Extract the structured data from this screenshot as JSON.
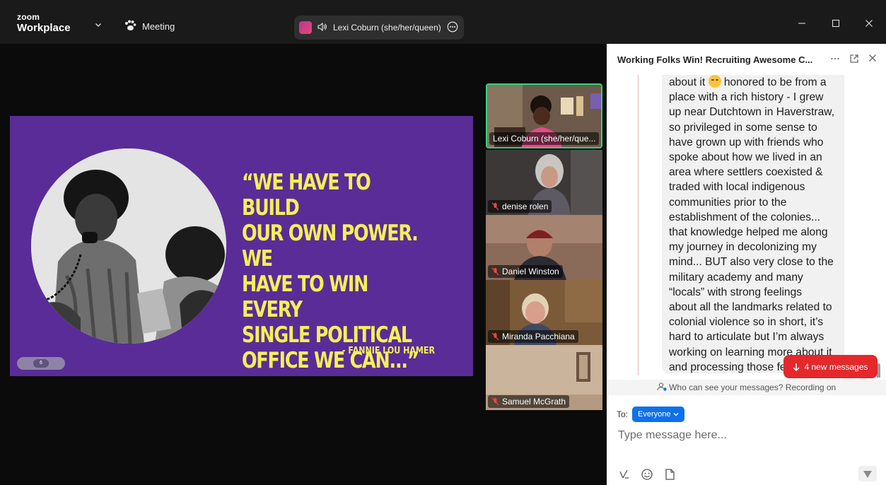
{
  "titlebar": {
    "brand_top": "zoom",
    "brand_bottom": "Workplace",
    "meeting_label": "Meeting",
    "active_speaker": "Lexi Coburn (she/her/queen)"
  },
  "slide": {
    "quote": "“WE HAVE TO BUILD\nOUR OWN POWER. WE\nHAVE TO WIN EVERY\nSINGLE POLITICAL\nOFFICE WE CAN...”",
    "attribution": "-   FANNIE LOU HAMER",
    "page_number": "6"
  },
  "participants": [
    {
      "name": "Lexi Coburn (she/her/que...",
      "muted": false,
      "active": true
    },
    {
      "name": "denise rolen",
      "muted": true,
      "active": false
    },
    {
      "name": "Daniel Winston",
      "muted": true,
      "active": false
    },
    {
      "name": "Miranda Pacchiana",
      "muted": true,
      "active": false
    },
    {
      "name": "Samuel McGrath",
      "muted": true,
      "active": false
    }
  ],
  "chat": {
    "title": "Working Folks Win! Recruiting Awesome C...",
    "message_lines": [
      "about it",
      " honored to be from a",
      "place with a rich history - I grew",
      "up near Dutchtown in Haverstraw,",
      "so privileged in some sense to",
      "have grown up with friends who",
      "spoke about how we lived in an",
      "area where settlers coexisted &",
      "traded with local indigenous",
      "communities prior to the",
      "establishment of the colonies...",
      "that knowledge helped me along",
      "my journey in decolonizing my",
      "mind... BUT also very close to the",
      "military academy and many",
      "“locals” with strong feelings",
      "about all the landmarks related to",
      "colonial violence so in short, it’s",
      "hard to articulate but I’m always",
      "working on learning more about it",
      "and processing those fe"
    ],
    "new_messages": "4 new messages",
    "privacy_notice": "Who can see your messages? Recording on",
    "to_label": "To:",
    "recipient": "Everyone",
    "input_placeholder": "Type message here..."
  },
  "colors": {
    "slide_bg": "#5a2c97",
    "quote_yellow": "#f3f058",
    "active_tile_border": "#2fd47e",
    "alert_red": "#e4282b",
    "accent_blue": "#0e71eb"
  }
}
